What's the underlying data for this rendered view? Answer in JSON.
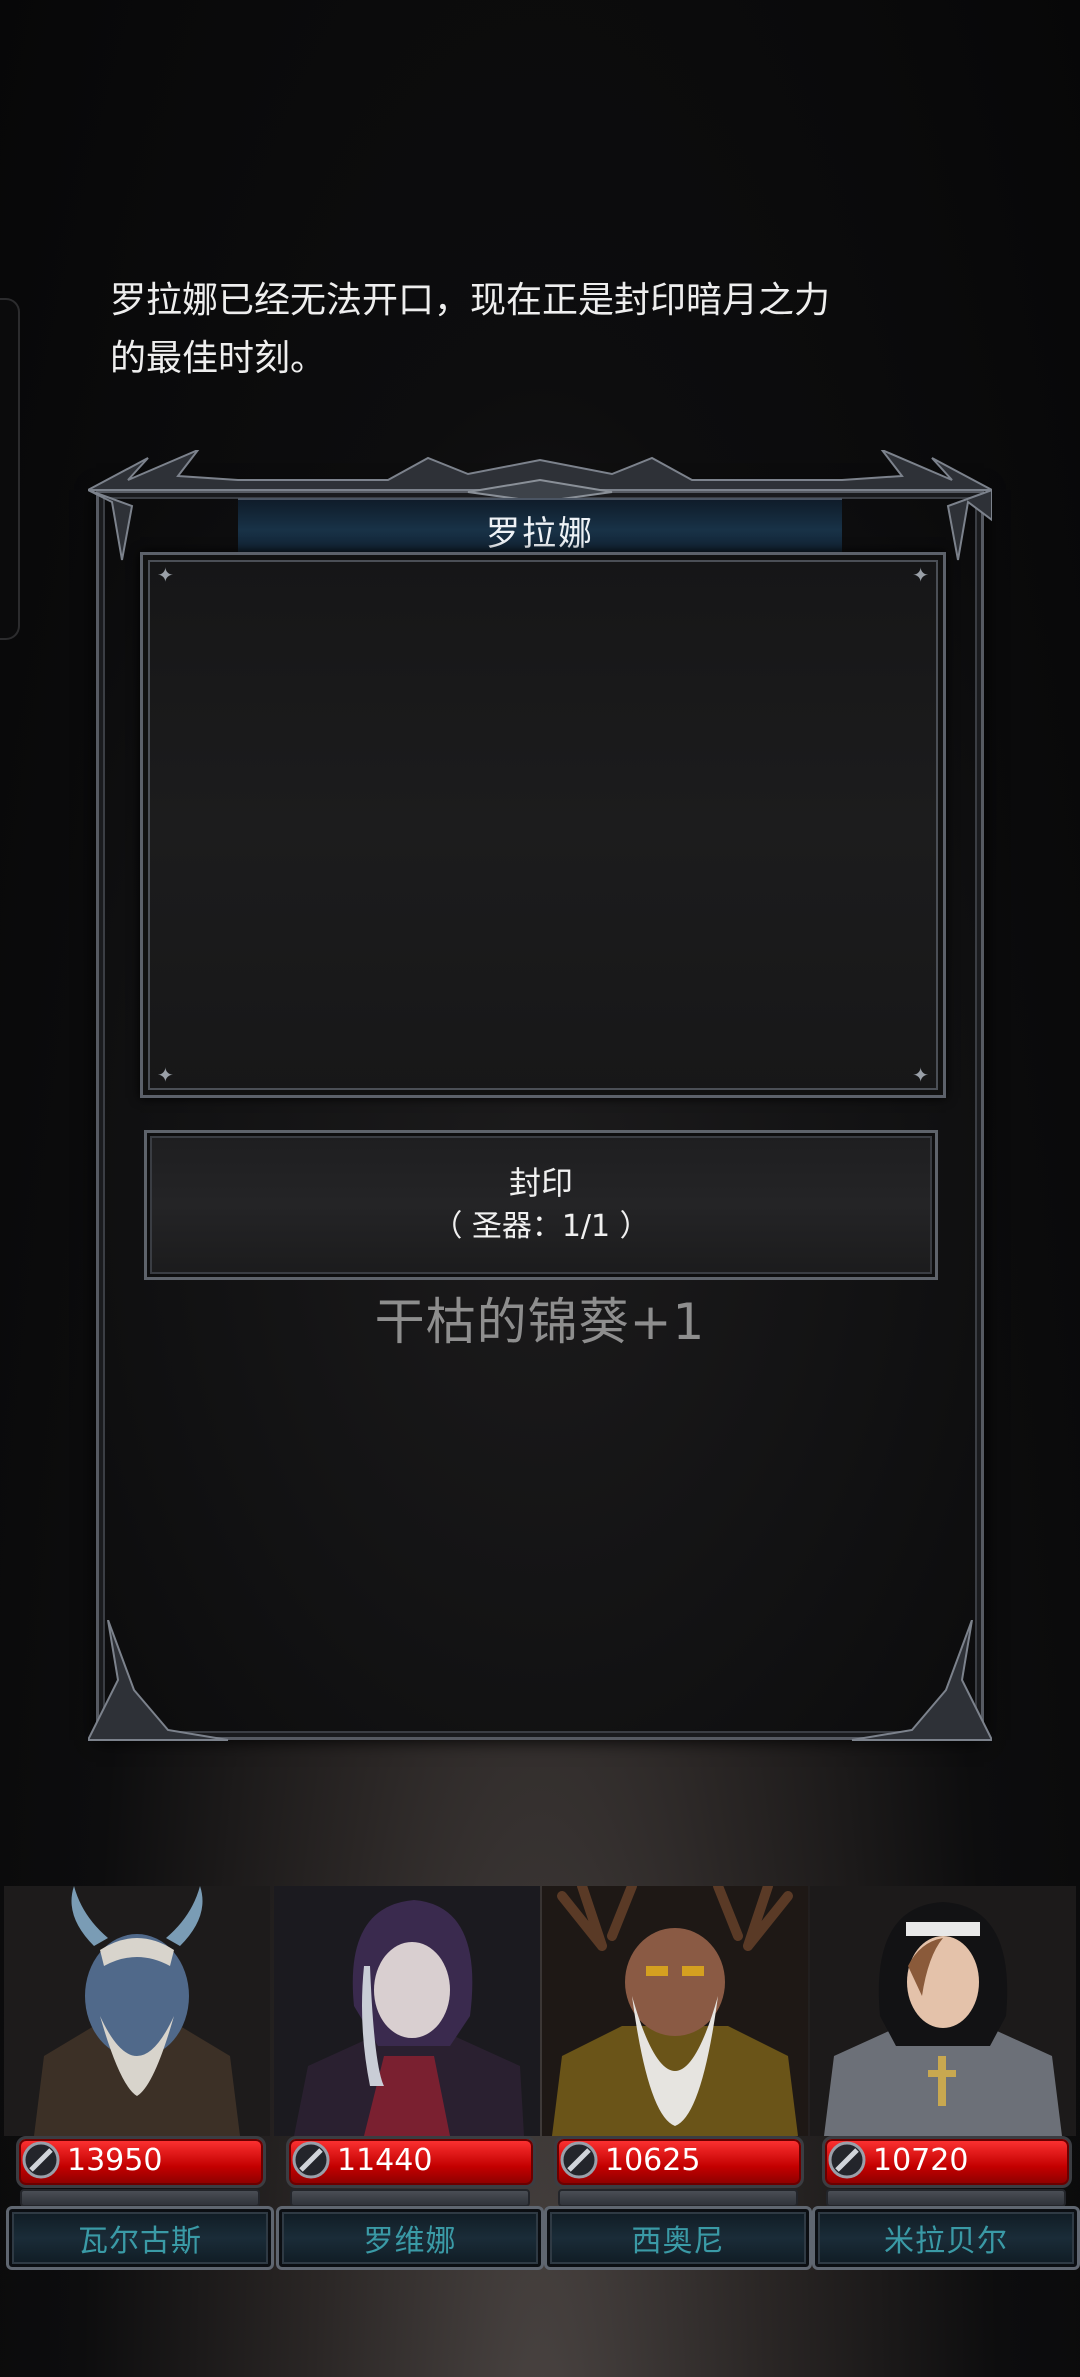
{
  "dialog": {
    "title": "罗拉娜",
    "message": "罗拉娜已经无法开口，现在正是封印暗月之力的最佳时刻。",
    "action": {
      "label": "封印",
      "requirement": "（ 圣器：1/1 ）"
    },
    "reward_text": "干枯的锦葵+1"
  },
  "party": [
    {
      "name": "瓦尔古斯",
      "hp": "13950",
      "portrait": "horned-warrior-portrait"
    },
    {
      "name": "罗维娜",
      "hp": "11440",
      "portrait": "hooded-sorceress-portrait"
    },
    {
      "name": "西奥尼",
      "hp": "10625",
      "portrait": "antlered-elder-portrait"
    },
    {
      "name": "米拉贝尔",
      "hp": "10720",
      "portrait": "nun-fighter-portrait"
    }
  ],
  "colors": {
    "hp_bar": "#c30000",
    "name_text": "#3a9aa6",
    "title_bar": "#183247",
    "reward_text": "#8e8e8e"
  }
}
